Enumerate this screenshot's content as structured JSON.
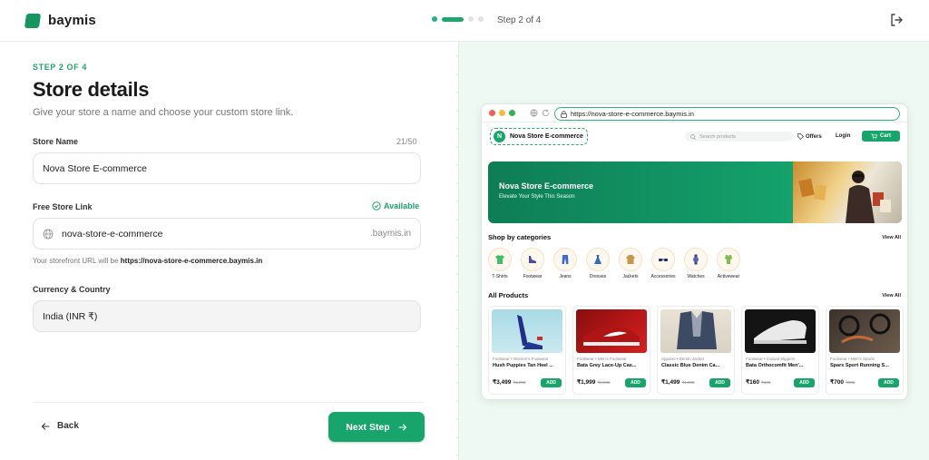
{
  "app": {
    "name": "baymis"
  },
  "progress": {
    "step_label": "Step 2 of 4",
    "current": 2,
    "total": 4
  },
  "form": {
    "eyebrow": "STEP 2 OF 4",
    "title": "Store details",
    "subtitle": "Give your store a name and choose your custom store link.",
    "store_name": {
      "label": "Store Name",
      "counter": "21/50",
      "value": "Nova Store E-commerce"
    },
    "store_link": {
      "label": "Free Store Link",
      "status": "Available",
      "value": "nova-store-e-commerce",
      "suffix": ".baymis.in",
      "hint_prefix": "Your storefront URL will be",
      "hint_url": "https://nova-store-e-commerce.baymis.in"
    },
    "currency": {
      "label": "Currency & Country",
      "value": "India (INR ₹)"
    },
    "back_label": "Back",
    "next_label": "Next Step"
  },
  "preview": {
    "url": "https://nova-store-e-commerce.baymis.in",
    "brand_initial": "N",
    "brand": "Nova Store E-commerce",
    "search_placeholder": "Search products",
    "offers": "Offers",
    "login": "Login",
    "cart": "Cart",
    "hero_title": "Nova Store E-commerce",
    "hero_subtitle": "Elevate Your Style This Season",
    "categories_title": "Shop by categories",
    "products_title": "All Products",
    "view_all": "View All",
    "categories": [
      {
        "label": "T-Shirts",
        "icon": "tshirt-icon"
      },
      {
        "label": "Footwear",
        "icon": "shoe-icon"
      },
      {
        "label": "Jeans",
        "icon": "jeans-icon"
      },
      {
        "label": "Dresses",
        "icon": "dress-icon"
      },
      {
        "label": "Jackets",
        "icon": "jacket-icon"
      },
      {
        "label": "Accessories",
        "icon": "sunglasses-icon"
      },
      {
        "label": "Watches",
        "icon": "watch-icon"
      },
      {
        "label": "Activewear",
        "icon": "activewear-icon"
      }
    ],
    "products": [
      {
        "category": "Footwear • Women's Footwear",
        "name": "Hush Puppies Tan Heel ...",
        "price": "₹3,499",
        "old_price": "₹4,999",
        "add": "ADD"
      },
      {
        "category": "Footwear • Men's Footwear",
        "name": "Bata Grey Lace-Up Cas...",
        "price": "₹1,999",
        "old_price": "₹2,500",
        "add": "ADD"
      },
      {
        "category": "Apparel • Denim Jacket",
        "name": "Classic Blue Denim Ca...",
        "price": "₹1,499",
        "old_price": "₹1,999",
        "add": "ADD"
      },
      {
        "category": "Footwear • Casual Slippers",
        "name": "Bata Orthocomfit Men'...",
        "price": "₹160",
        "old_price": "₹199",
        "add": "ADD"
      },
      {
        "category": "Footwear • Men's Sports",
        "name": "Sparx Sport Running S...",
        "price": "₹700",
        "old_price": "₹999",
        "add": "ADD"
      }
    ]
  },
  "colors": {
    "accent": "#17a56b",
    "preview_bg": "#eef9f3"
  }
}
